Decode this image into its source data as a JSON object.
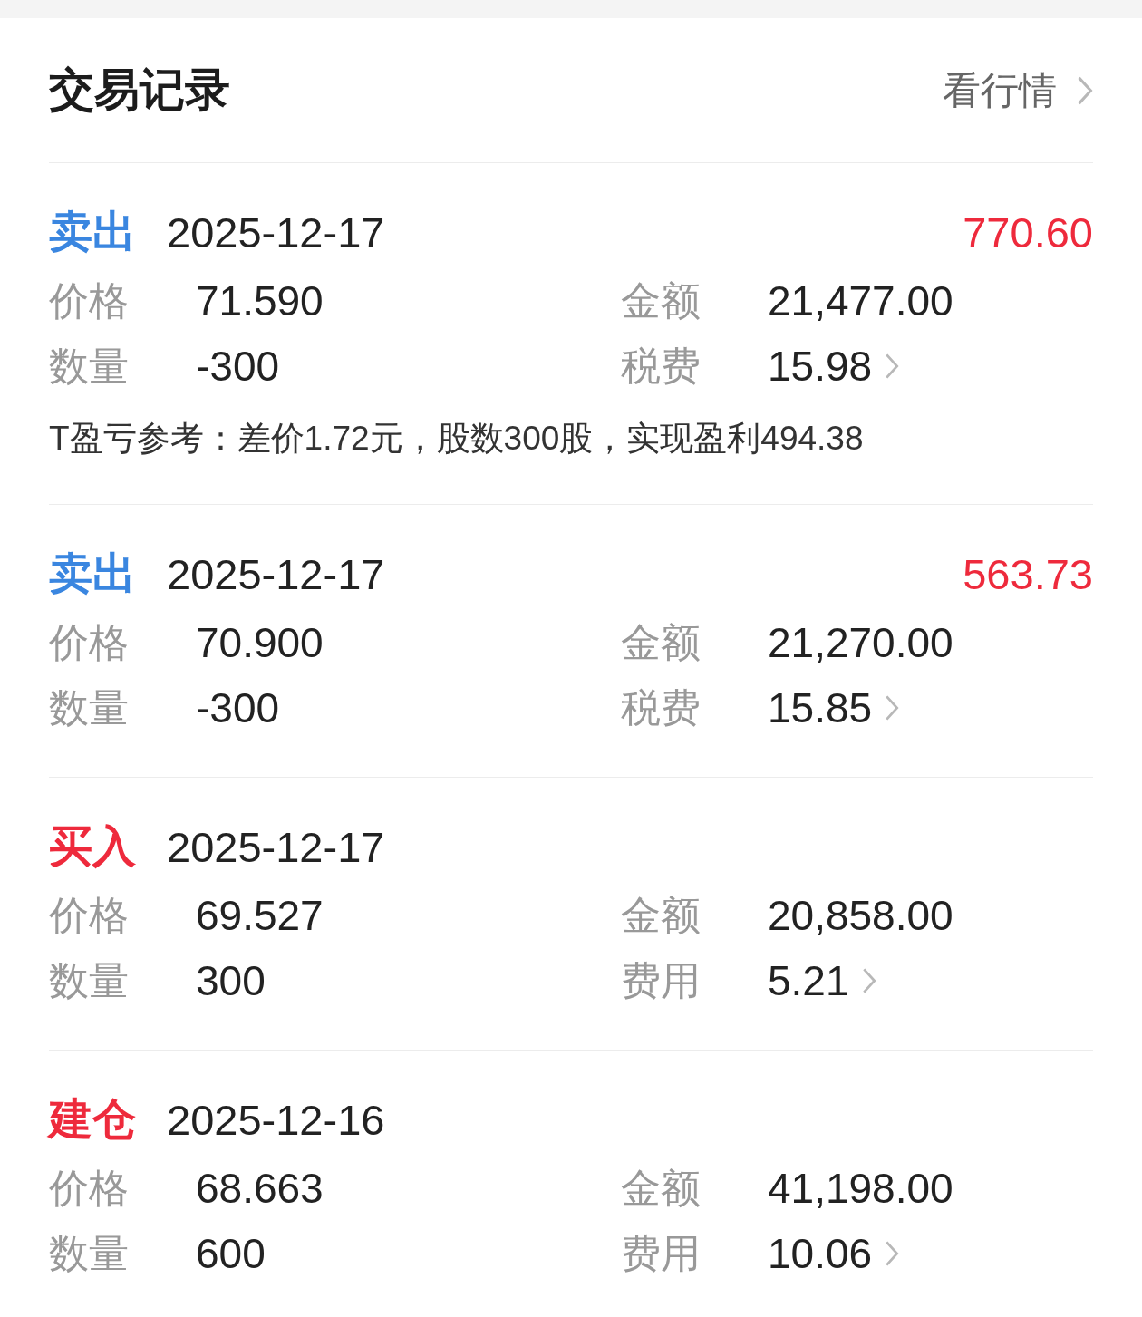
{
  "header": {
    "title": "交易记录",
    "link": "看行情"
  },
  "records": [
    {
      "type": "卖出",
      "color": "#3a86e0",
      "date": "2025-12-17",
      "amount": "770.60",
      "fields": [
        {
          "kind": "plain",
          "label": "价格",
          "value": "71.590"
        },
        {
          "kind": "plain",
          "label": "金额",
          "value": "21,477.00"
        },
        {
          "kind": "plain",
          "label": "数量",
          "value": "-300"
        },
        {
          "kind": "fee",
          "label": "税费",
          "value": "15.98"
        }
      ],
      "note": "T盈亏参考：差价1.72元，股数300股，实现盈利494.38"
    },
    {
      "type": "卖出",
      "color": "#3a86e0",
      "date": "2025-12-17",
      "amount": "563.73",
      "fields": [
        {
          "kind": "plain",
          "label": "价格",
          "value": "70.900"
        },
        {
          "kind": "plain",
          "label": "金额",
          "value": "21,270.00"
        },
        {
          "kind": "plain",
          "label": "数量",
          "value": "-300"
        },
        {
          "kind": "fee",
          "label": "税费",
          "value": "15.85"
        }
      ]
    },
    {
      "type": "买入",
      "color": "#ee2a3c",
      "date": "2025-12-17",
      "fields": [
        {
          "kind": "plain",
          "label": "价格",
          "value": "69.527"
        },
        {
          "kind": "plain",
          "label": "金额",
          "value": "20,858.00"
        },
        {
          "kind": "plain",
          "label": "数量",
          "value": "300"
        },
        {
          "kind": "fee",
          "label": "费用",
          "value": "5.21"
        }
      ]
    },
    {
      "type": "建仓",
      "color": "#ee2a3c",
      "date": "2025-12-16",
      "fields": [
        {
          "kind": "plain",
          "label": "价格",
          "value": "68.663"
        },
        {
          "kind": "plain",
          "label": "金额",
          "value": "41,198.00"
        },
        {
          "kind": "plain",
          "label": "数量",
          "value": "600"
        },
        {
          "kind": "fee",
          "label": "费用",
          "value": "10.06"
        }
      ]
    }
  ]
}
